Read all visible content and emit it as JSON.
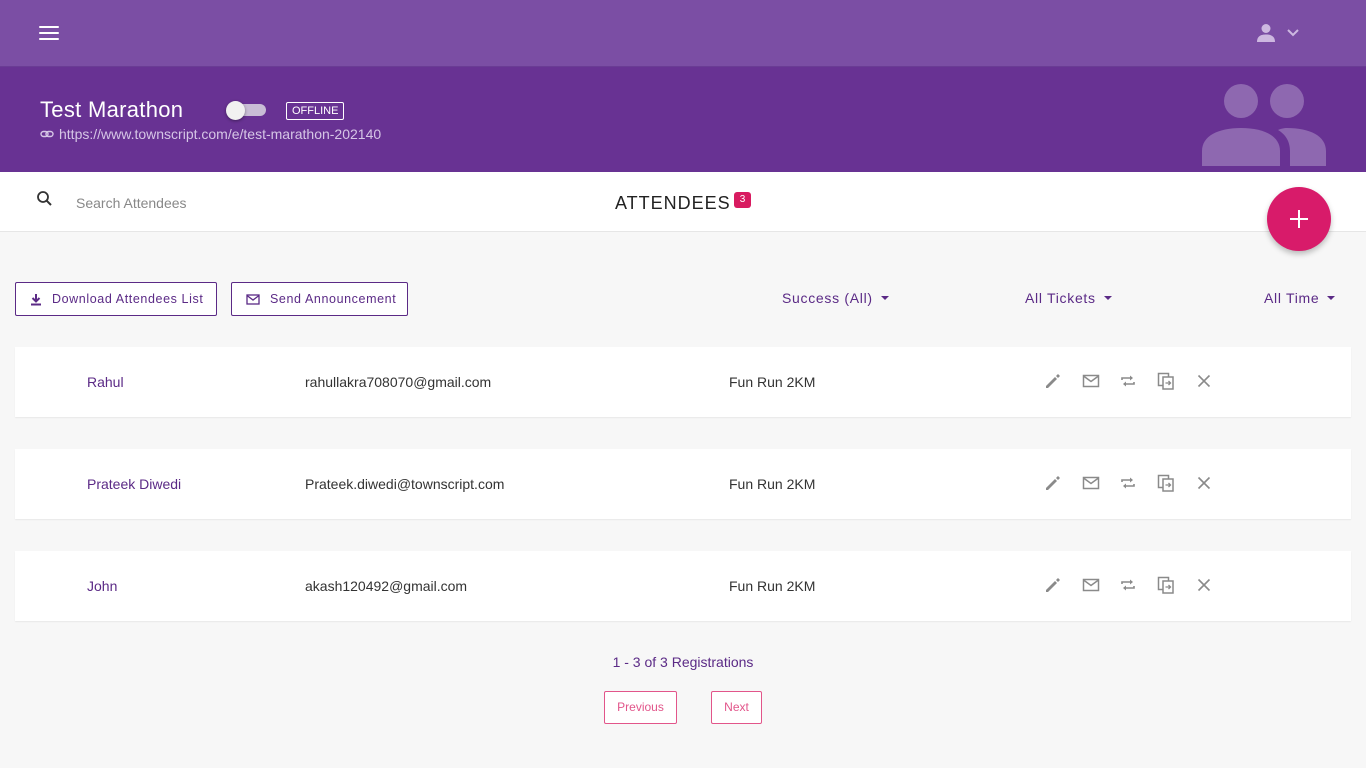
{
  "topbar": {
    "menu_icon": "hamburger-icon",
    "user_icon": "user-icon"
  },
  "event": {
    "title": "Test Marathon",
    "status": "OFFLINE",
    "toggle_on": false,
    "url": "https://www.townscript.com/e/test-marathon-202140"
  },
  "attendees_bar": {
    "search_placeholder": "Search Attendees",
    "title": "ATTENDEES",
    "count": "3"
  },
  "toolbar": {
    "download_label": "Download Attendees List",
    "announce_label": "Send Announcement"
  },
  "filters": {
    "status": "Success (All)",
    "tickets": "All Tickets",
    "time": "All Time"
  },
  "attendees": [
    {
      "name": "Rahul",
      "email": "rahullakra708070@gmail.com",
      "ticket": "Fun Run 2KM"
    },
    {
      "name": "Prateek Diwedi",
      "email": "Prateek.diwedi@townscript.com",
      "ticket": "Fun Run 2KM"
    },
    {
      "name": "John",
      "email": "akash120492@gmail.com",
      "ticket": "Fun Run 2KM"
    }
  ],
  "row_actions": [
    "edit-icon",
    "mail-icon",
    "repeat-icon",
    "copy-icon",
    "close-icon"
  ],
  "pagination": {
    "info": "1 - 3 of 3 Registrations",
    "previous": "Previous",
    "next": "Next"
  },
  "colors": {
    "primary": "#683293",
    "topbar": "#7b4ea4",
    "accent": "#d81b6a"
  }
}
